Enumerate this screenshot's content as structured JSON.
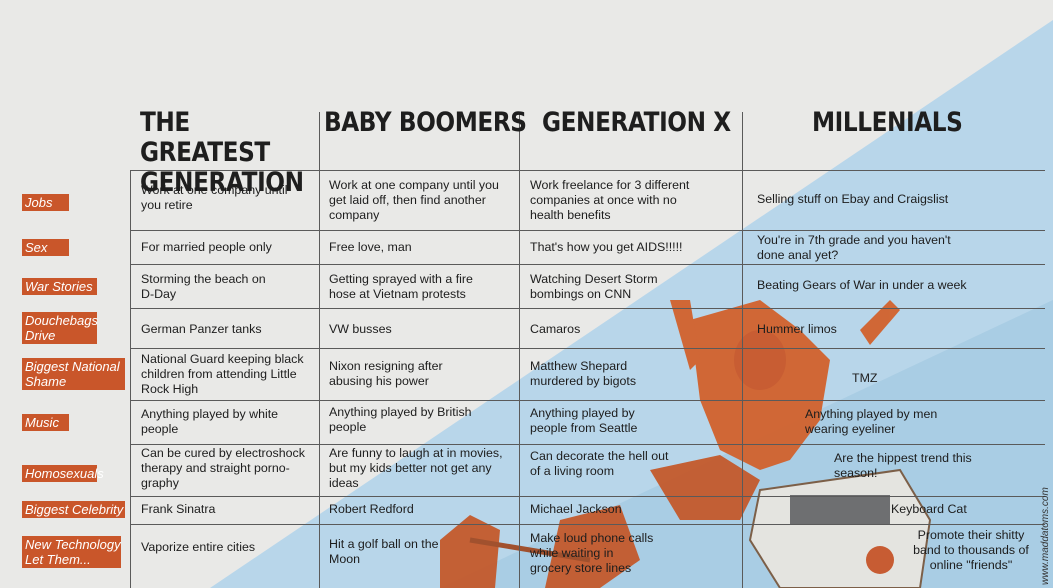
{
  "colors": {
    "accent": "#c9562a",
    "blue": "#b5d6ea",
    "paper": "#e9e9e7"
  },
  "headers": [
    "THE GREATEST GENERATION",
    "BABY BOOMERS",
    "GENERATION X",
    "MILLENIALS"
  ],
  "rows": [
    {
      "label": "Jobs",
      "cells": [
        "Work at one company until you retire",
        "Work at one company until you get laid off, then find another company",
        "Work freelance for 3 different companies at once with no health benefits",
        "Selling stuff on Ebay and Craigslist"
      ]
    },
    {
      "label": "Sex",
      "cells": [
        "For married people only",
        "Free love, man",
        "That's how you get AIDS!!!!!",
        "You're in 7th grade and you haven't done anal yet?"
      ]
    },
    {
      "label": "War Stories",
      "cells": [
        "Storming the beach on D-Day",
        "Getting sprayed with a fire hose at Vietnam protests",
        "Watching Desert Storm bombings on CNN",
        "Beating Gears of War in under a week"
      ]
    },
    {
      "label": "Douchebags Drive",
      "cells": [
        "German Panzer tanks",
        "VW busses",
        "Camaros",
        "Hummer limos"
      ]
    },
    {
      "label": "Biggest National Shame",
      "cells": [
        "National Guard keeping black children from attending Little Rock High",
        "Nixon resigning after abusing his power",
        "Matthew Shepard murdered by bigots",
        "TMZ"
      ]
    },
    {
      "label": "Music",
      "cells": [
        "Anything played by white people",
        "Anything played by British people",
        "Anything played by people from Seattle",
        "Anything played by men wearing eyeliner"
      ]
    },
    {
      "label": "Homosexuals",
      "cells": [
        "Can be cured by electroshock therapy and straight porno-graphy",
        "Are funny to laugh at in movies, but my kids better not get any ideas",
        "Can decorate the hell out of a living room",
        "Are the hippest trend this season!"
      ]
    },
    {
      "label": "Biggest Celebrity",
      "cells": [
        "Frank Sinatra",
        "Robert Redford",
        "Michael Jackson",
        "Keyboard Cat"
      ]
    },
    {
      "label": "New Technology Let Them...",
      "cells": [
        "Vaporize entire cities",
        "Hit a golf ball on the Moon",
        "Make loud phone calls while waiting in grocery store lines",
        "Promote their shitty band to thousands of online \"friends\""
      ]
    }
  ],
  "credit": "www.maddatoms.com"
}
